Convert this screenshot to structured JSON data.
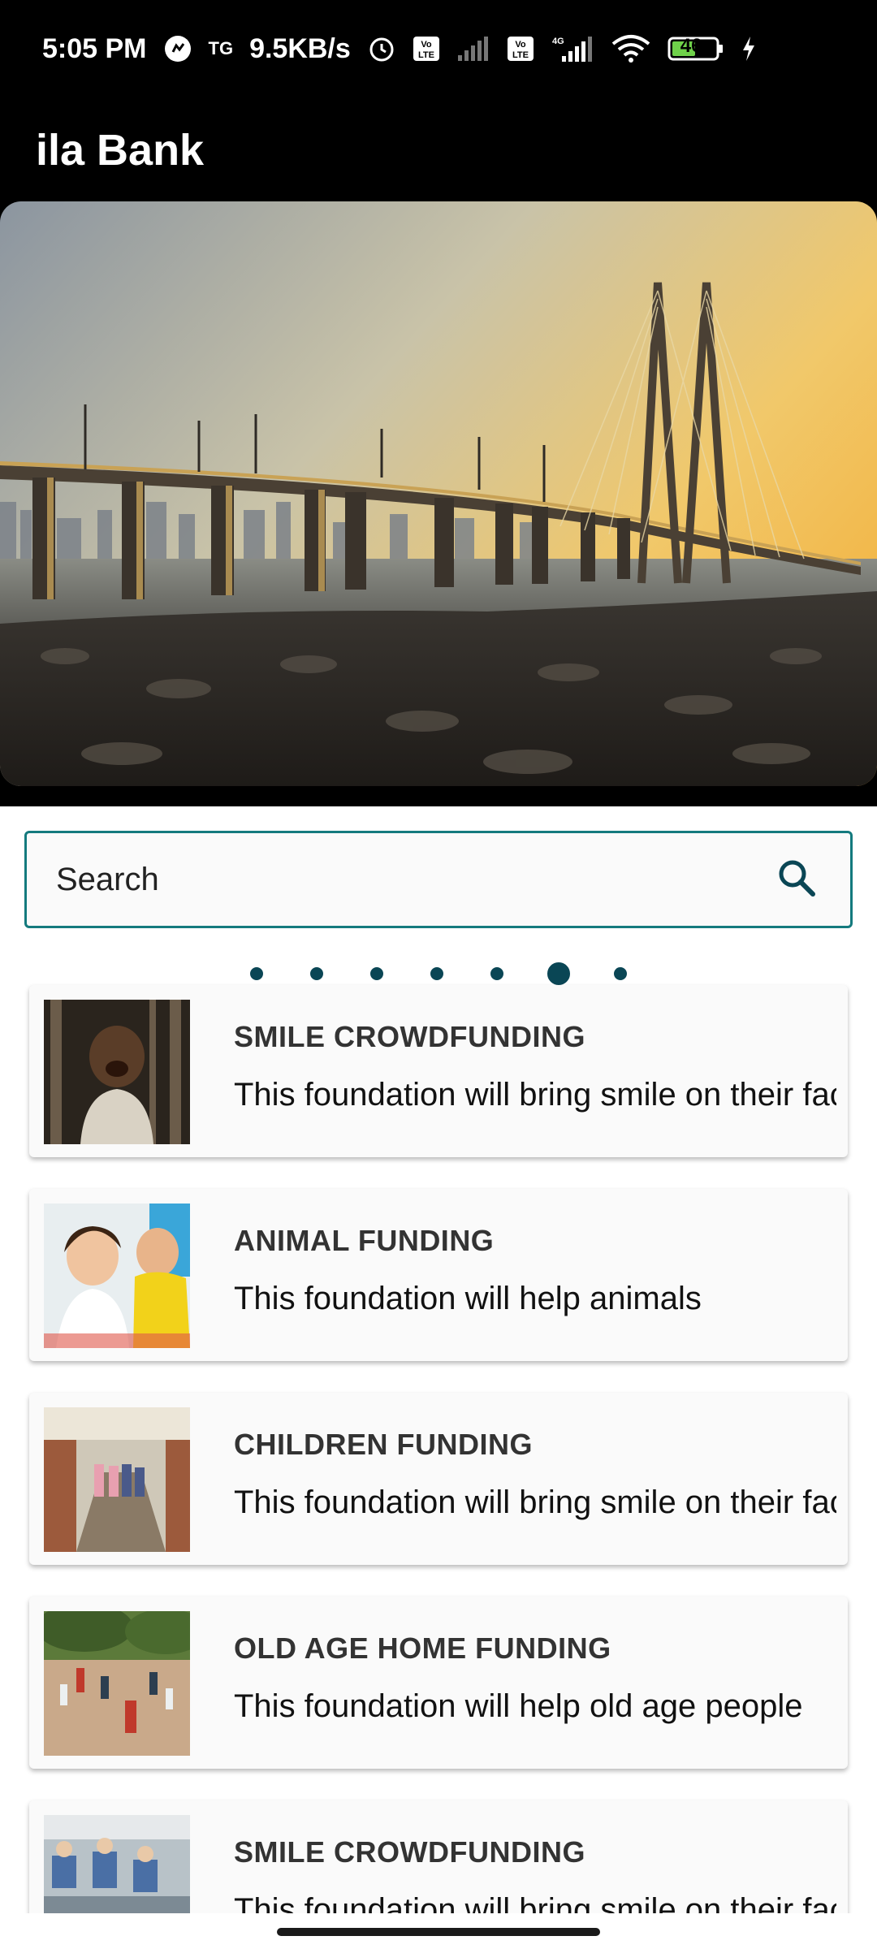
{
  "status_bar": {
    "time": "5:05 PM",
    "tg_label": "TG",
    "speed": "9.5KB/s",
    "battery": "46",
    "network_4g": "4G",
    "volte": "Vo LTE",
    "icons": [
      "messenger-icon",
      "alarm-icon",
      "volte-icon",
      "signal-icon",
      "volte-icon",
      "signal-4g-icon",
      "wifi-icon",
      "battery-icon",
      "charging-icon"
    ]
  },
  "app_bar": {
    "title": "ila Bank"
  },
  "banner": {
    "slide_count": 7,
    "active_index": 5
  },
  "search": {
    "placeholder": "Search",
    "value": ""
  },
  "list": [
    {
      "title": "SMILE CROWDFUNDING",
      "description": "This foundation will bring smile on their faces"
    },
    {
      "title": "ANIMAL FUNDING",
      "description": "This foundation will help animals"
    },
    {
      "title": "CHILDREN FUNDING",
      "description": "This foundation will bring smile on their faces"
    },
    {
      "title": "OLD AGE HOME FUNDING",
      "description": "This foundation will help old age people"
    },
    {
      "title": "SMILE CROWDFUNDING",
      "description": "This foundation will bring smile on their faces"
    }
  ],
  "colors": {
    "accent": "#147a7e",
    "dot": "#0a4655",
    "appbar": "#000000"
  }
}
